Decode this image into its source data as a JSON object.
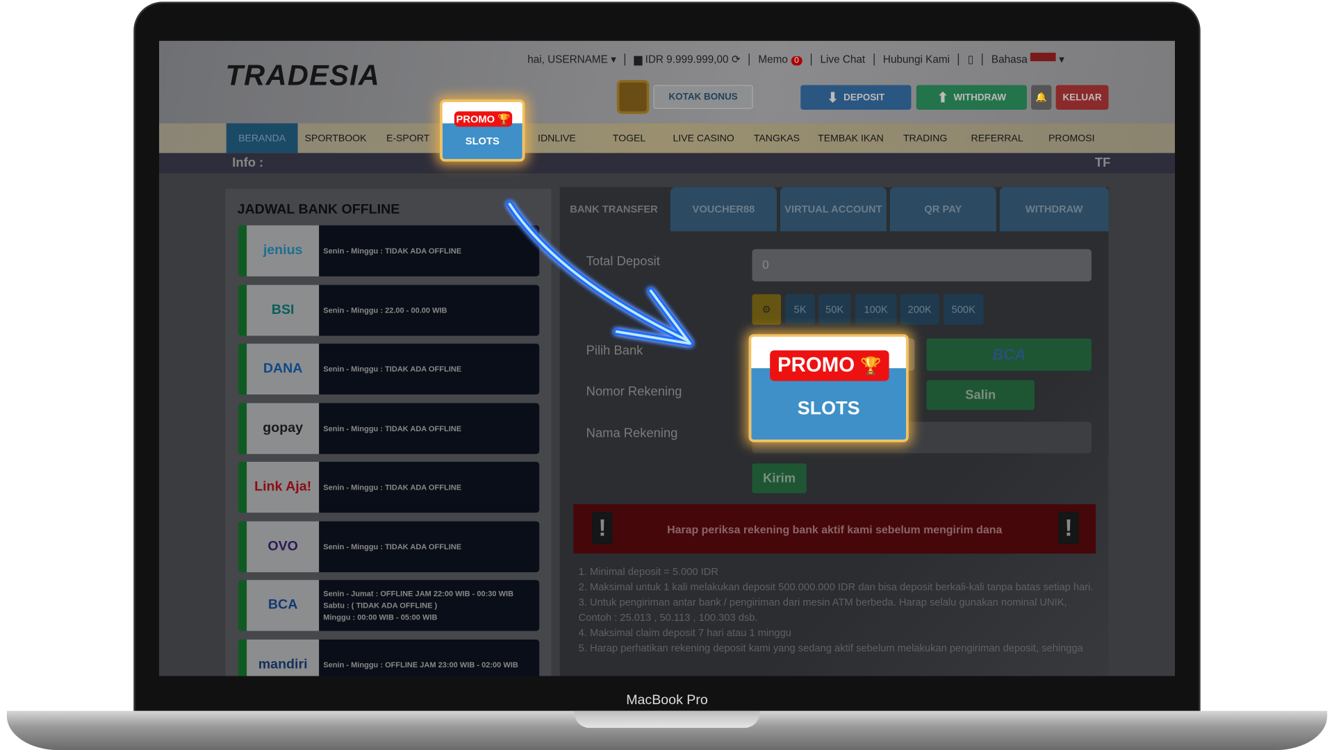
{
  "device": {
    "label": "MacBook Pro"
  },
  "header": {
    "logo": "TRADESIA",
    "greeting": "hai, USERNAME",
    "balance": "IDR 9.999.999,00",
    "memo": "Memo",
    "memo_count": "0",
    "live_chat": "Live Chat",
    "contact": "Hubungi Kami",
    "language": "Bahasa",
    "kotak_bonus": "KOTAK BONUS",
    "deposit": "DEPOSIT",
    "withdraw": "WITHDRAW",
    "logout": "KELUAR"
  },
  "nav": {
    "items": [
      "BERANDA",
      "SPORTBOOK",
      "E-SPORT",
      "SLOTS",
      "IDNLIVE",
      "TOGEL",
      "LIVE CASINO",
      "TANGKAS",
      "TEMBAK IKAN",
      "TRADING",
      "REFERRAL",
      "PROMOSI"
    ],
    "active": "BERANDA"
  },
  "info": {
    "label": "Info :",
    "marquee": "TF"
  },
  "promo": {
    "badge": "PROMO",
    "label": "SLOTS"
  },
  "schedule": {
    "title": "JADWAL BANK OFFLINE",
    "banks": [
      {
        "name": "jenius",
        "lines": [
          "Senin - Minggu : TIDAK ADA OFFLINE"
        ],
        "color": "#1d6f91"
      },
      {
        "name": "BSI",
        "lines": [
          "Senin - Minggu : 22.00 - 00.00 WIB"
        ],
        "color": "#0a5e5a"
      },
      {
        "name": "DANA",
        "lines": [
          "Senin - Minggu : TIDAK ADA OFFLINE"
        ],
        "color": "#0d4a86"
      },
      {
        "name": "gopay",
        "lines": [
          "Senin - Minggu : TIDAK ADA OFFLINE"
        ],
        "color": "#1a1a1a"
      },
      {
        "name": "Link Aja!",
        "lines": [
          "Senin - Minggu : TIDAK ADA OFFLINE"
        ],
        "color": "#8a0d12"
      },
      {
        "name": "OVO",
        "lines": [
          "Senin - Minggu : TIDAK ADA OFFLINE"
        ],
        "color": "#2c1a55"
      },
      {
        "name": "BCA",
        "lines": [
          "Senin - Jumat : OFFLINE JAM 22:00 WIB - 00:30 WIB",
          "Sabtu : ( TIDAK ADA OFFLINE )",
          "Minggu : 00:00 WIB - 05:00 WIB"
        ],
        "color": "#123a70"
      },
      {
        "name": "mandiri",
        "lines": [
          "Senin - Minggu : OFFLINE JAM 23:00 WIB - 02:00 WIB"
        ],
        "color": "#14305a"
      }
    ]
  },
  "deposit": {
    "tabs": [
      "BANK TRANSFER",
      "VOUCHER88",
      "VIRTUAL ACCOUNT",
      "QR PAY",
      "WITHDRAW"
    ],
    "active_tab": "BANK TRANSFER",
    "total_label": "Total Deposit",
    "total_value": "0",
    "chips": [
      "5K",
      "50K",
      "100K",
      "200K",
      "500K"
    ],
    "bank_label": "Pilih Bank",
    "account_no_label": "Nomor Rekening",
    "account_name_label": "Nama Rekening",
    "selected_bank": "BCA",
    "copy": "Salin",
    "submit": "Kirim",
    "warning": "Harap periksa rekening bank aktif kami sebelum mengirim dana",
    "rules": [
      "1. Minimal deposit = 5.000 IDR",
      "2. Maksimal untuk 1 kali melakukan deposit 500.000.000 IDR dan bisa deposit berkali-kali tanpa batas setiap hari.",
      "3. Untuk pengiriman antar bank / pengiriman dari mesin ATM berbeda. Harap selalu gunakan nominal UNIK, Contoh : 25.013 , 50.113 , 100.303 dsb.",
      "4. Maksimal claim deposit 7 hari atau 1 minggu",
      "5. Harap perhatikan rekening deposit kami yang sedang aktif sebelum melakukan pengiriman deposit, sehingga"
    ]
  }
}
